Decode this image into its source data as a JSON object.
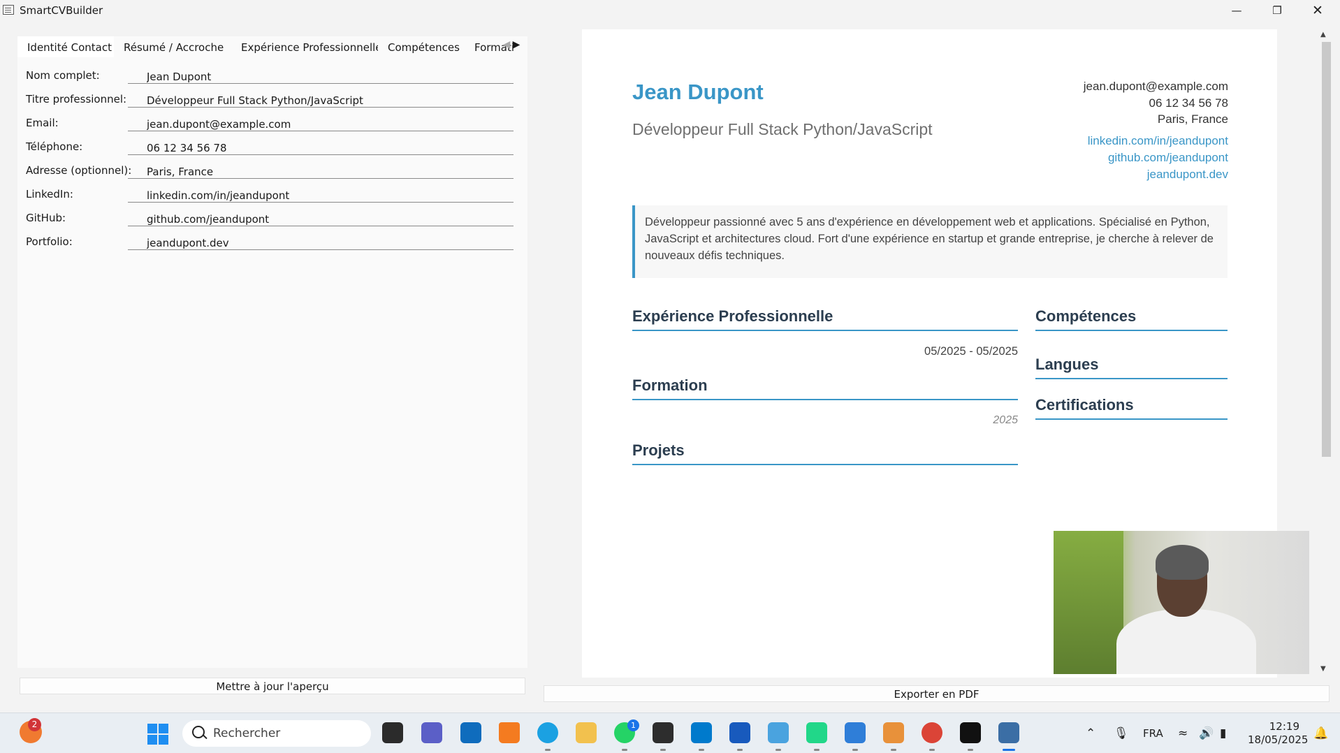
{
  "window": {
    "title": "SmartCVBuilder"
  },
  "tabs": [
    {
      "label": "Identité  Contact",
      "active": true
    },
    {
      "label": "Résumé / Accroche"
    },
    {
      "label": "Expérience Professionnelle"
    },
    {
      "label": "Compétences"
    },
    {
      "label": "Formati"
    }
  ],
  "form": {
    "fields": [
      {
        "label": "Nom complet:",
        "value": "Jean Dupont"
      },
      {
        "label": "Titre professionnel:",
        "value": "Développeur Full Stack Python/JavaScript"
      },
      {
        "label": "Email:",
        "value": "jean.dupont@example.com"
      },
      {
        "label": "Téléphone:",
        "value": "06 12 34 56 78"
      },
      {
        "label": "Adresse (optionnel):",
        "value": "Paris, France"
      },
      {
        "label": "LinkedIn:",
        "value": "linkedin.com/in/jeandupont"
      },
      {
        "label": "GitHub:",
        "value": "github.com/jeandupont"
      },
      {
        "label": "Portfolio:",
        "value": "jeandupont.dev"
      }
    ]
  },
  "buttons": {
    "update": "Mettre à jour l'aperçu",
    "export": "Exporter en PDF"
  },
  "cv": {
    "name": "Jean Dupont",
    "title": "Développeur Full Stack Python/JavaScript",
    "email": "jean.dupont@example.com",
    "phone": "06 12 34 56 78",
    "address": "Paris, France",
    "linkedin": "linkedin.com/in/jeandupont",
    "github": "github.com/jeandupont",
    "portfolio": "jeandupont.dev",
    "summary": "Développeur passionné avec 5 ans d'expérience en développement web et applications. Spécialisé en Python, JavaScript et architectures cloud. Fort d'une expérience en startup et grande entreprise, je cherche à relever de nouveaux défis techniques.",
    "sections": {
      "experience": "Expérience Professionnelle",
      "experience_dates": "05/2025 - 05/2025",
      "education": "Formation",
      "education_year": "2025",
      "projects": "Projets",
      "skills": "Compétences",
      "languages": "Langues",
      "certifications": "Certifications"
    },
    "accent_color": "#3a96c7"
  },
  "taskbar": {
    "search_placeholder": "Rechercher",
    "notification_count": "2",
    "whatsapp_badge": "1",
    "language": "FRA",
    "time": "12:19",
    "date": "18/05/2025"
  }
}
